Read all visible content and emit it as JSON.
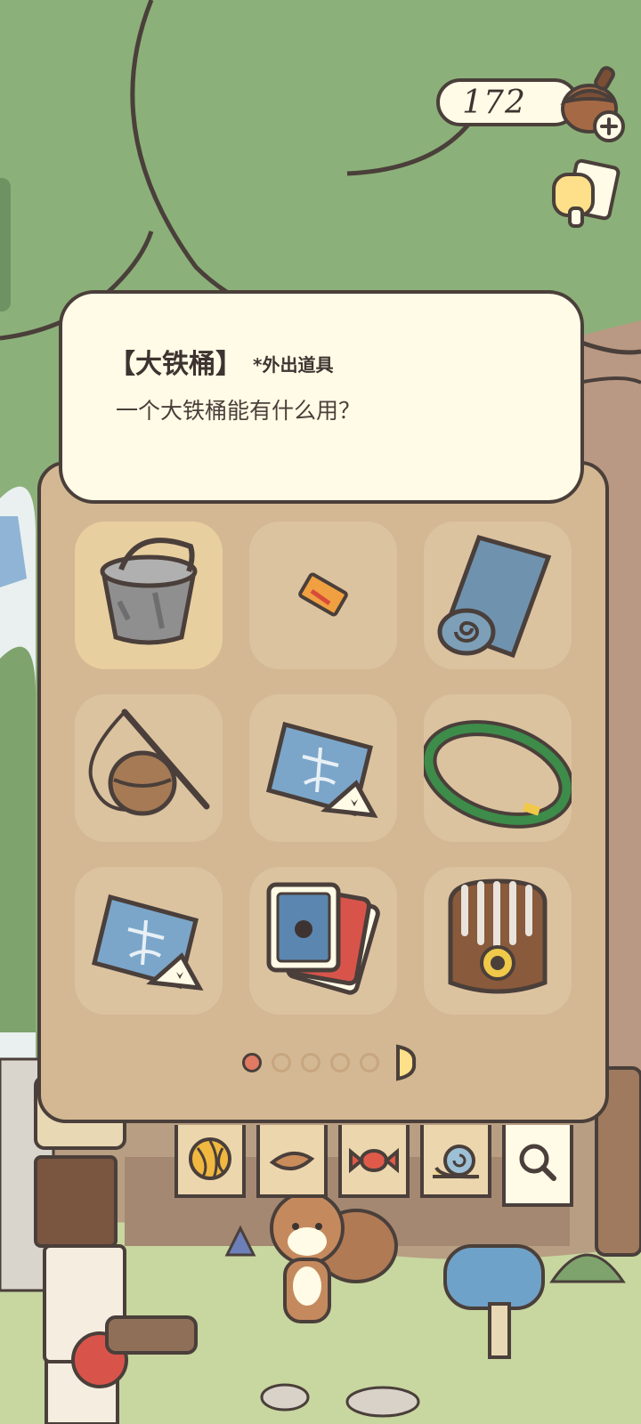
{
  "currency": {
    "amount": "172",
    "icon": "acorn-icon"
  },
  "item_info": {
    "title": "【大铁桶】",
    "tag": "*外出道具",
    "description": "一个大铁桶能有什么用？"
  },
  "inventory": {
    "items": [
      {
        "icon": "metal-bucket-icon",
        "selected": true
      },
      {
        "icon": "ticket-icon",
        "selected": false
      },
      {
        "icon": "rolled-mat-icon",
        "selected": false
      },
      {
        "icon": "fishing-rod-basket-icon",
        "selected": false
      },
      {
        "icon": "map-with-pie-icon",
        "selected": false
      },
      {
        "icon": "green-hoop-icon",
        "selected": false
      },
      {
        "icon": "map-with-pie-icon",
        "selected": false
      },
      {
        "icon": "playing-cards-icon",
        "selected": false
      },
      {
        "icon": "kalimba-icon",
        "selected": false
      }
    ],
    "pagination": {
      "current": 1,
      "total": 5
    }
  },
  "category_tabs": [
    {
      "icon": "yarn-ball-icon"
    },
    {
      "icon": "leaf-food-icon"
    },
    {
      "icon": "candy-icon"
    },
    {
      "icon": "snail-icon"
    },
    {
      "icon": "magnifier-icon"
    }
  ],
  "colors": {
    "outline": "#4a3f3a",
    "card": "#fffbe6",
    "panel": "#d3b893",
    "tree": "#8cb079",
    "active_dot": "#e07a63"
  }
}
